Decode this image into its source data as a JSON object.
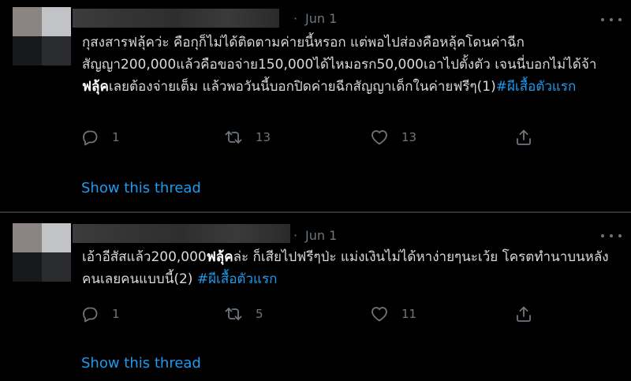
{
  "tweets": [
    {
      "date": "Jun 1",
      "dot": "·",
      "text_part1": "กุสงสารฟลุ้คว่ะ คือกุก็ไม่ได้ติดตามค่ายนี้หรอก แต่พอไปส่องคือหลุ้คโดนค่าฉีกสัญญา200,000แล้วคือขอจ่าย150,000ได้ไหมอรก50,000เอาไปตั้งตัว เจนนี่บอกไม่ได้จ้า",
      "bold": "ฟลุ้ค",
      "text_part2": "เลยต้องจ่ายเต็ม แล้วพอวันนี้บอกปิดค่ายฉีกสัญญาเด็กในค่ายฟรีๆ(1)",
      "hashtag": "#ผีเสื้อตัวแรก",
      "replies": "1",
      "retweets": "13",
      "likes": "13",
      "show_thread": "Show this thread"
    },
    {
      "date": "Jun 1",
      "dot": "·",
      "text_part1": "เอ้าอีสัสแล้ว200,000",
      "bold": "ฟลุ้ค",
      "text_part2": "ล่ะ ก็เสียไปฟรีๆป่ะ แม่งเงินไม่ได้หาง่ายๆนะเว้ย โครตทำนาบนหลังคนเลยคนแบบนี้(2) ",
      "hashtag": "#ผีเสื้อตัวแรก",
      "replies": "1",
      "retweets": "5",
      "likes": "11",
      "show_thread": "Show this thread"
    }
  ],
  "icons": [
    "reply-icon",
    "retweet-icon",
    "like-icon",
    "share-icon",
    "more-icon"
  ],
  "colors": {
    "background": "#000000",
    "text": "#d9d9d9",
    "muted": "#6e767d",
    "link": "#1d9bf0",
    "divider": "#2f3336"
  }
}
